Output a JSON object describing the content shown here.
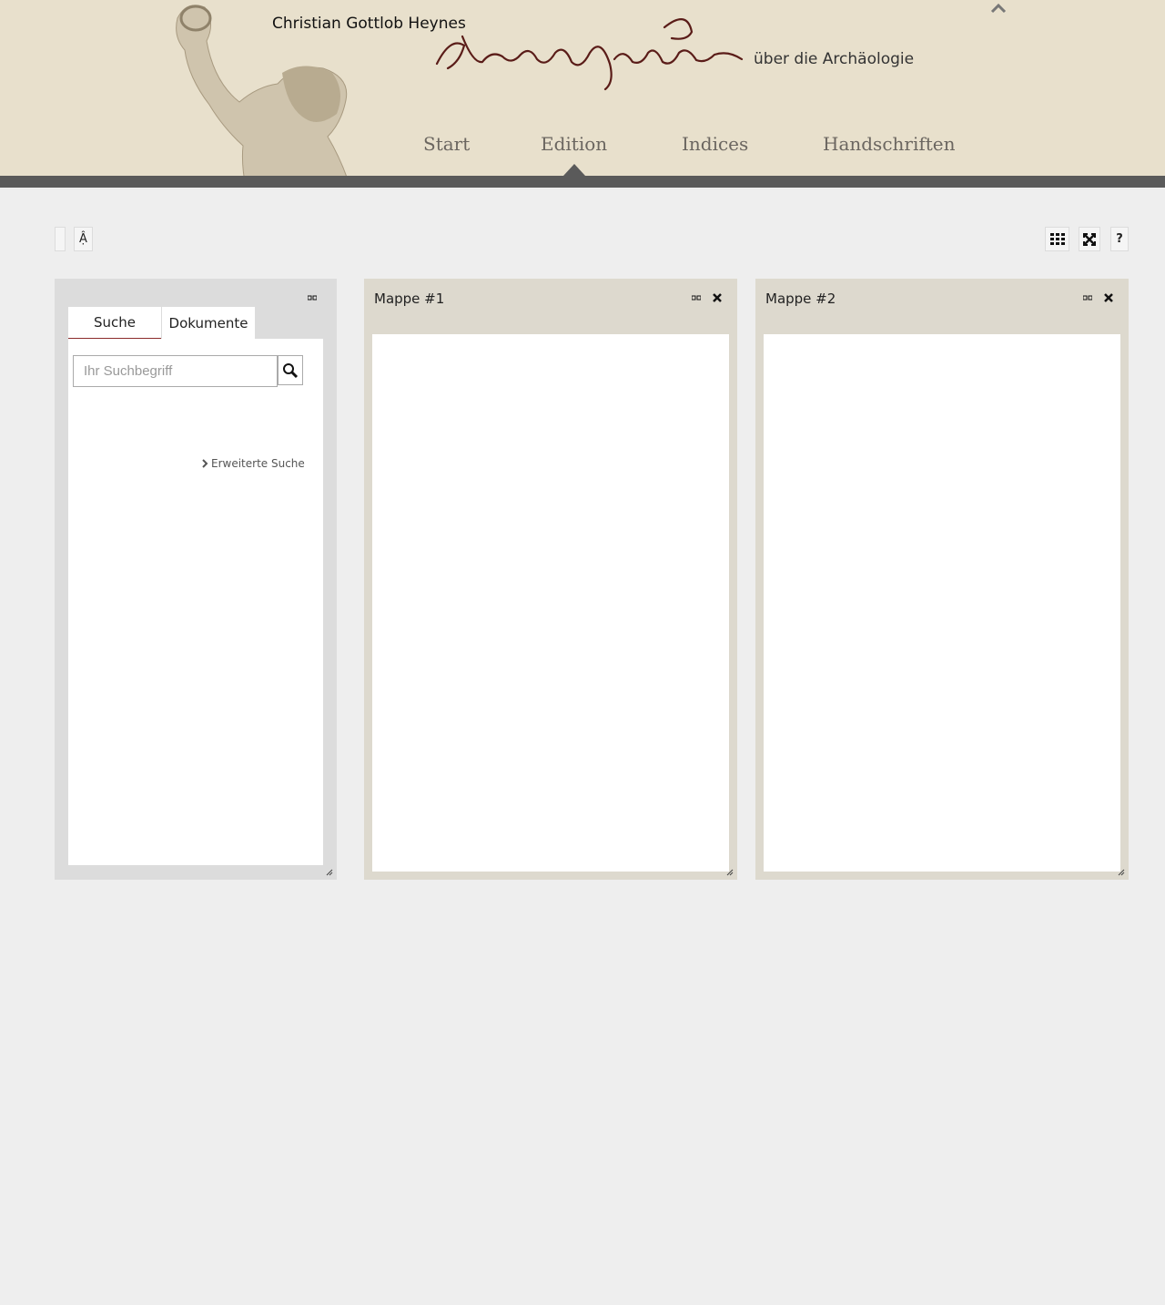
{
  "header": {
    "author": "Christian Gottlob Heynes",
    "subtitle": "über die Archäologie",
    "nav": [
      {
        "label": "Start"
      },
      {
        "label": "Edition"
      },
      {
        "label": "Indices"
      },
      {
        "label": "Handschriften"
      }
    ],
    "active_nav": "Edition",
    "signature_text": "Vorlesungen",
    "colors": {
      "header_bg": "#e8e0cc",
      "header_bar": "#5a5a5a",
      "nav_text": "#6b6660"
    }
  },
  "toolbar": {
    "font_button_label": "Ậ",
    "help_label": "?"
  },
  "search_panel": {
    "tabs": [
      {
        "label": "Suche"
      },
      {
        "label": "Dokumente"
      }
    ],
    "active_tab": "Suche",
    "search_placeholder": "Ihr Suchbegriff",
    "search_value": "",
    "advanced_link": "Erweiterte Suche"
  },
  "folders": [
    {
      "title": "Mappe #1"
    },
    {
      "title": "Mappe #2"
    }
  ],
  "icons": [
    "chevron-up-icon",
    "grid-icon",
    "fullscreen-icon",
    "minimize-icon",
    "close-icon",
    "search-icon",
    "chevron-right-icon",
    "resize-handle-icon"
  ]
}
